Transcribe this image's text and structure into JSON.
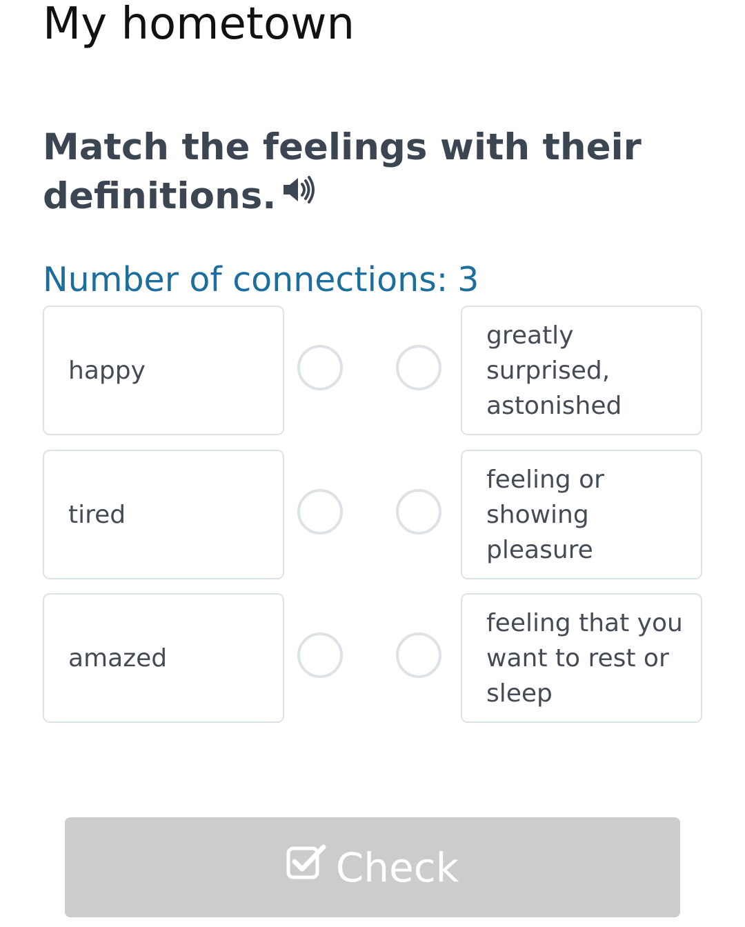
{
  "page": {
    "title": "My hometown"
  },
  "exercise": {
    "instruction": "Match the feelings with their definitions.",
    "connections_label": "Number of connections:",
    "connections_count": "3",
    "accent_color": "#1c6e9e"
  },
  "pairs": [
    {
      "left": "happy",
      "right": "greatly surprised, astonished"
    },
    {
      "left": "tired",
      "right": "feeling or showing pleasure"
    },
    {
      "left": "amazed",
      "right": "feeling that you want to rest or sleep"
    }
  ],
  "check_button": {
    "label": "Check",
    "icon": "checkbox-check-icon",
    "background": "#cccccc"
  },
  "icons": {
    "audio": "speaker-icon"
  }
}
